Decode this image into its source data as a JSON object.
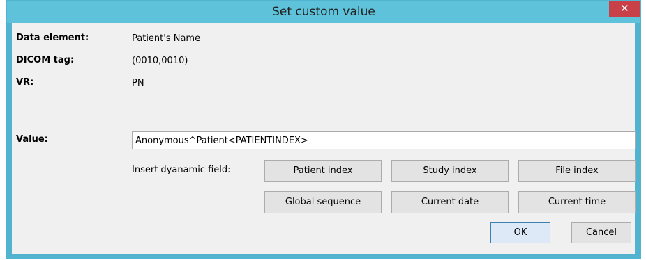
{
  "window": {
    "title": "Set custom value",
    "close_glyph": "✕",
    "close_icon": "close-icon"
  },
  "info": {
    "data_element_label": "Data element:",
    "data_element_value": "Patient's Name",
    "dicom_tag_label": "DICOM tag:",
    "dicom_tag_value": "(0010,0010)",
    "vr_label": "VR:",
    "vr_value": "PN"
  },
  "value_field": {
    "label": "Value:",
    "value": "Anonymous^Patient<PATIENTINDEX>"
  },
  "dynamic": {
    "label": "Insert dyanamic field:",
    "buttons": [
      "Patient index",
      "Study index",
      "File index",
      "Global sequence",
      "Current date",
      "Current time"
    ]
  },
  "actions": {
    "ok": "OK",
    "cancel": "Cancel"
  },
  "colors": {
    "titlebar": "#5ec2db",
    "close": "#c84048",
    "body": "#f0f0f0"
  }
}
